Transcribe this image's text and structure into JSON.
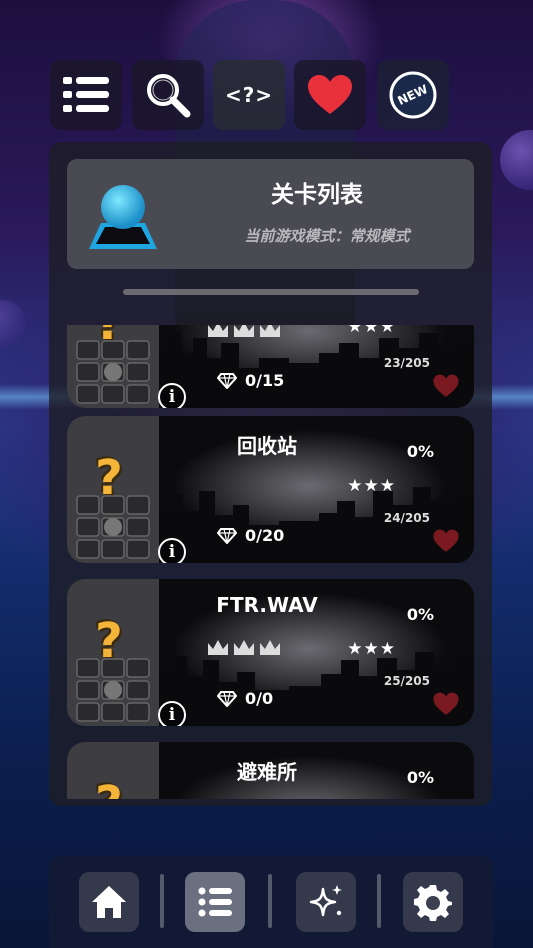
{
  "top_toolbar": {
    "icons": [
      "list-icon",
      "search-icon",
      "code-icon",
      "heart-icon",
      "new-badge-icon"
    ],
    "code_label": "<?>",
    "new_label": "NEW"
  },
  "header": {
    "title": "关卡列表",
    "subtitle": "当前游戏模式：常规模式"
  },
  "levels": [
    {
      "name": "",
      "percent": "",
      "stars": "★★★",
      "star_count": "23/205",
      "gems": "0/15",
      "crowns": true
    },
    {
      "name": "回收站",
      "percent": "0%",
      "stars": "★★★",
      "star_count": "24/205",
      "gems": "0/20",
      "crowns": false
    },
    {
      "name": "FTR.WAV",
      "percent": "0%",
      "stars": "★★★",
      "star_count": "25/205",
      "gems": "0/0",
      "crowns": true
    },
    {
      "name": "避难所",
      "percent": "0%",
      "stars": "",
      "star_count": "",
      "gems": "",
      "crowns": false
    }
  ],
  "level_common": {
    "question_mark": "?",
    "info_label": "i"
  },
  "bottom_nav": {
    "items": [
      "home-icon",
      "level-list-icon",
      "sparkle-icon",
      "settings-icon"
    ],
    "active": "level-list-icon"
  },
  "colors": {
    "accent_heart": "#e8313a",
    "dim_heart": "#7a1a20",
    "question": "#f4b43a"
  }
}
